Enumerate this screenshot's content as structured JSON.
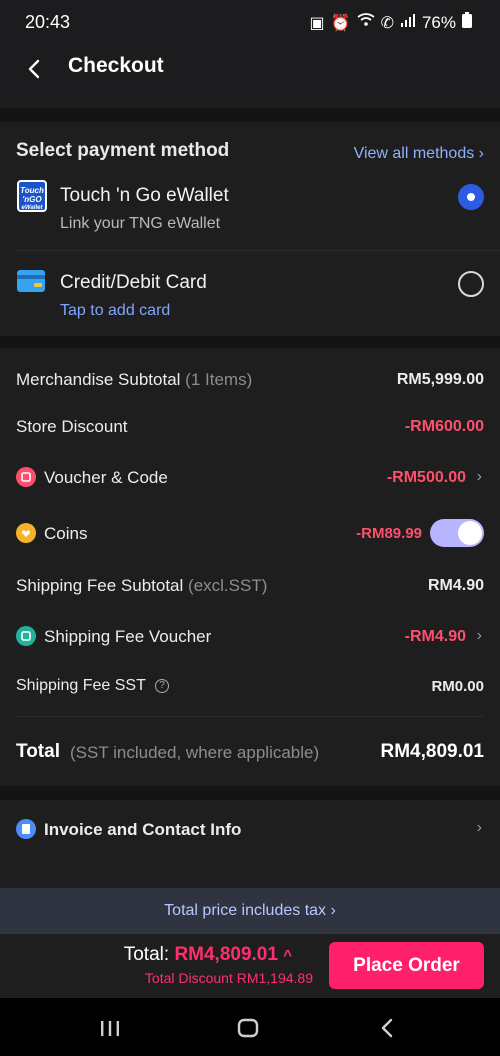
{
  "status": {
    "time": "20:43",
    "battery": "76%",
    "icons": [
      "android-icon",
      "alarm-icon",
      "wifi-icon",
      "call-icon",
      "signal-icon",
      "battery-icon"
    ]
  },
  "header": {
    "title": "Checkout"
  },
  "payment": {
    "title": "Select payment method",
    "view_all": "View all methods ›",
    "methods": [
      {
        "name": "Touch 'n Go eWallet",
        "sub": "Link your TNG eWallet",
        "selected": true,
        "logo_text_1": "Touch",
        "logo_text_2": "'nGO",
        "logo_text_3": "eWallet"
      },
      {
        "name": "Credit/Debit Card",
        "sub": "Tap to add card",
        "selected": false
      }
    ]
  },
  "summary": {
    "merch_label": "Merchandise Subtotal",
    "merch_note": "(1 Items)",
    "merch_value": "RM5,999.00",
    "store_discount_label": "Store Discount",
    "store_discount_value": "-RM600.00",
    "voucher_label": "Voucher & Code",
    "voucher_value": "-RM500.00",
    "coins_label": "Coins",
    "coins_value": "-RM89.99",
    "coins_enabled": true,
    "ship_label": "Shipping Fee Subtotal",
    "ship_note": "(excl.SST)",
    "ship_value": "RM4.90",
    "ship_voucher_label": "Shipping Fee Voucher",
    "ship_voucher_value": "-RM4.90",
    "ship_sst_label": "Shipping Fee SST",
    "ship_sst_value": "RM0.00",
    "total_label": "Total",
    "total_note": "(SST included, where applicable)",
    "total_value": "RM4,809.01"
  },
  "invoice": {
    "label": "Invoice and Contact Info"
  },
  "tax_bar": {
    "text": "Total price includes tax ›"
  },
  "bottom": {
    "total_label": "Total:",
    "total_amount": "RM4,809.01",
    "discount": "Total Discount RM1,194.89",
    "place_order": "Place Order"
  },
  "colors": {
    "accent": "#ff1f6a",
    "discount_red": "#ff4f6d",
    "link_blue": "#8fb0ff",
    "radio_blue": "#2d5be3"
  }
}
